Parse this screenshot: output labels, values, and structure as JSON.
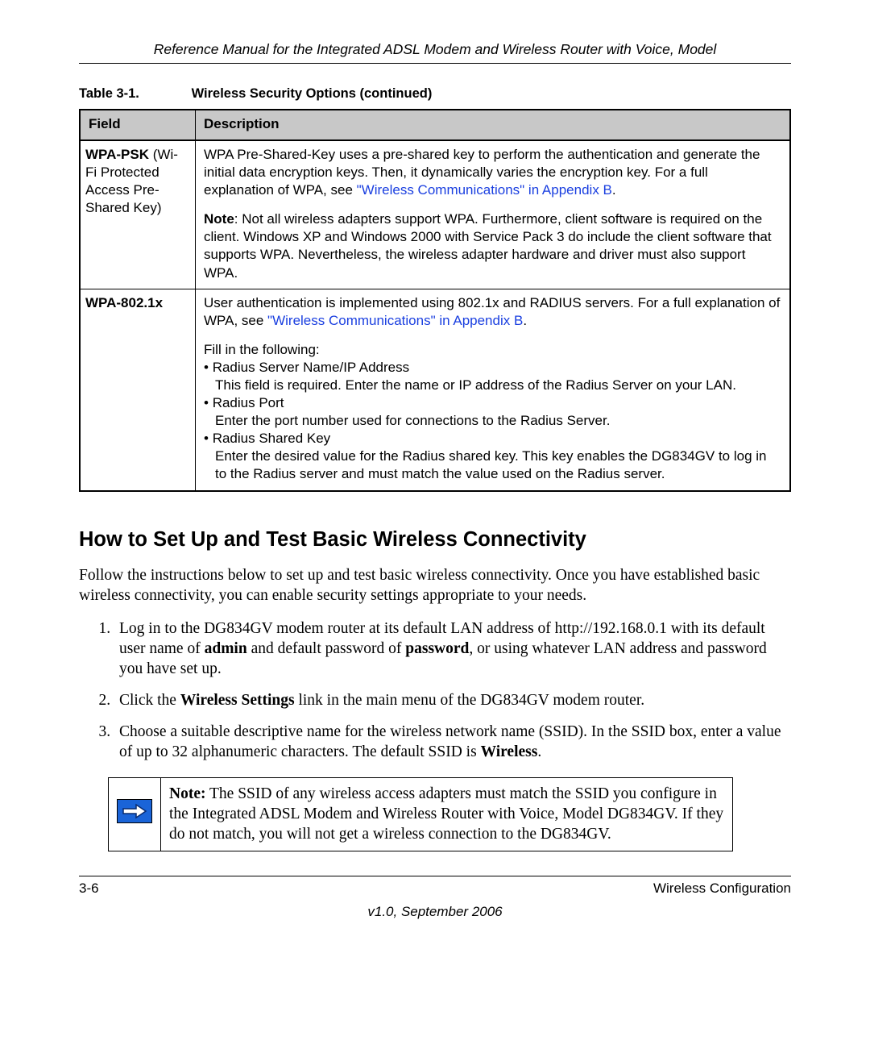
{
  "header": {
    "title": "Reference Manual for the Integrated ADSL Modem and Wireless Router with Voice, Model"
  },
  "table": {
    "caption_num": "Table 3-1.",
    "caption_title": "Wireless Security Options  (continued)",
    "head_field": "Field",
    "head_desc": "Description",
    "rows": {
      "r1": {
        "field_bold": "WPA-PSK",
        "field_rest": " (Wi-Fi Protected Access Pre-Shared Key)",
        "p1a": "WPA Pre-Shared-Key uses a pre-shared key to perform the authentication and generate the initial data encryption keys. Then, it dynamically varies the encryption key. For a full explanation of WPA, see ",
        "p1link": "\"Wireless Communications\" in Appendix B",
        "p1b": ".",
        "p2_bold": "Note",
        "p2_text": ": Not all wireless adapters support WPA. Furthermore, client software is required on the client. Windows XP and Windows 2000 with Service Pack 3 do include the client software that supports WPA. Nevertheless, the wireless adapter hardware and driver must also support WPA."
      },
      "r2": {
        "field_bold": "WPA-802.1x",
        "p1a": "User authentication is implemented using 802.1x and RADIUS servers. For a full explanation of WPA, see ",
        "p1link": "\"Wireless Communications\" in Appendix B",
        "p1b": ".",
        "fill_label": "Fill in the following:",
        "b1_title": "Radius Server Name/IP Address",
        "b1_desc": "This field is required. Enter the name or IP address of the Radius Server on your LAN.",
        "b2_title": "Radius Port",
        "b2_desc": "Enter the port number used for connections to the Radius Server.",
        "b3_title": "Radius Shared Key",
        "b3_desc": "Enter the desired value for the Radius shared key. This key enables the DG834GV to log in to the Radius server and must match the value used on the Radius server."
      }
    }
  },
  "section": {
    "heading": "How to Set Up and Test Basic Wireless Connectivity",
    "intro": "Follow the instructions below to set up and test basic wireless connectivity. Once you have established basic wireless connectivity, you can enable security settings appropriate to your needs.",
    "steps": {
      "s1a": "Log in to the DG834GV modem router at its default LAN address of http://192.168.0.1 with its default user name of ",
      "s1b1": "admin",
      "s1c": " and default password of ",
      "s1b2": "password",
      "s1d": ", or using whatever LAN address and password you have set up.",
      "s2a": "Click the ",
      "s2b": "Wireless Settings",
      "s2c": " link in the main menu of the DG834GV modem router.",
      "s3a": "Choose a suitable descriptive name for the wireless network name (SSID). In the SSID box, enter a value of up to 32 alphanumeric characters. The default SSID is ",
      "s3b": "Wireless",
      "s3c": "."
    },
    "note_bold": "Note:",
    "note_text": " The SSID of any wireless access adapters must match the SSID you configure in the Integrated ADSL Modem and Wireless Router with Voice, Model DG834GV. If they do not match, you will not get a wireless connection to the DG834GV."
  },
  "footer": {
    "pagenum": "3-6",
    "section": "Wireless Configuration",
    "version": "v1.0, September 2006"
  }
}
